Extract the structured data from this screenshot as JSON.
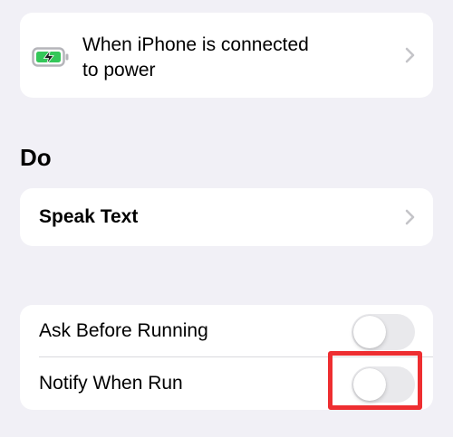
{
  "trigger": {
    "icon": "battery-charging-icon",
    "line1": "When iPhone is connected",
    "line2": "to power"
  },
  "section": {
    "heading": "Do"
  },
  "action": {
    "label": "Speak Text"
  },
  "options": {
    "ask_before_running": {
      "label": "Ask Before Running",
      "enabled": false
    },
    "notify_when_run": {
      "label": "Notify When Run",
      "enabled": false
    }
  },
  "colors": {
    "background": "#f1f0f6",
    "card": "#ffffff",
    "battery_green": "#34c759",
    "toggle_off": "#e9e9ec",
    "highlight": "#ee2e31",
    "chevron": "#c4c4c8"
  }
}
